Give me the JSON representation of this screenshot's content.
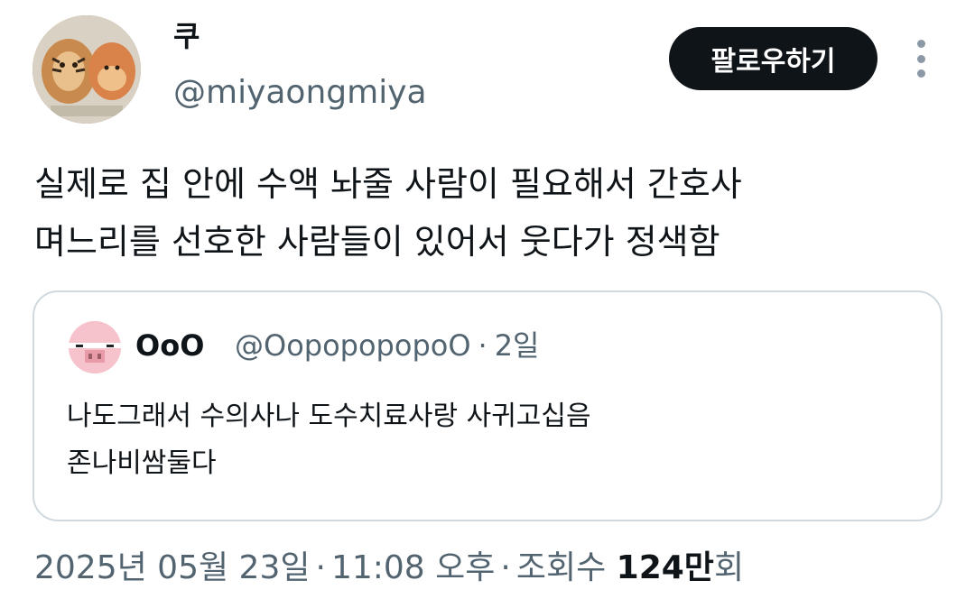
{
  "author": {
    "display_name": "쿠",
    "handle": "@miyaongmiya"
  },
  "follow_label": "팔로우하기",
  "tweet": {
    "lines": [
      "실제로 집 안에 수액 놔줄 사람이 필요해서 간호사",
      "며느리를 선호한 사람들이 있어서 웃다가 정색함"
    ]
  },
  "quote": {
    "display_name": "OoO",
    "handle": "@OopopopopoO",
    "separator": "·",
    "time": "2일",
    "lines": [
      "나도그래서 수의사나 도수치료사랑 사귀고십음",
      "존나비쌈둘다"
    ]
  },
  "meta": {
    "date": "2025년 05월 23일",
    "separator": "·",
    "time": "11:08 오후",
    "views_label": "조회수",
    "views_count": "124만",
    "views_suffix": "회"
  },
  "icons": {
    "more": "more-vertical-icon"
  }
}
